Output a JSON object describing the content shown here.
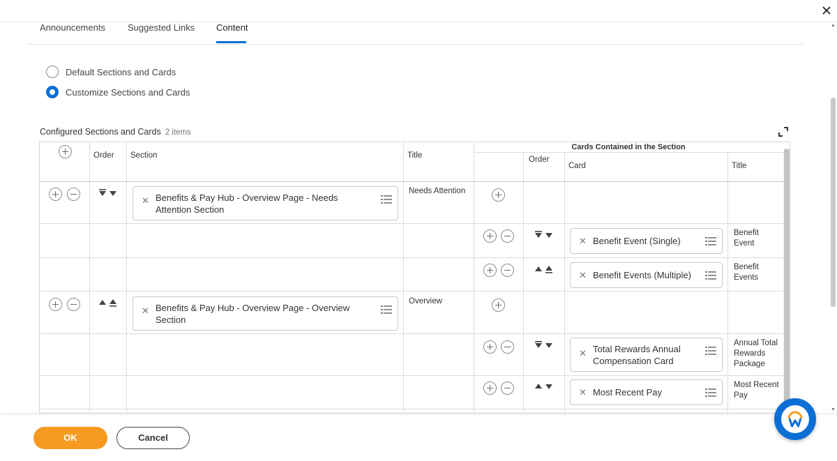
{
  "tabs": [
    {
      "label": "Announcements"
    },
    {
      "label": "Suggested Links"
    },
    {
      "label": "Content"
    }
  ],
  "options": [
    {
      "label": "Default Sections and Cards",
      "selected": false
    },
    {
      "label": "Customize Sections and Cards",
      "selected": true
    }
  ],
  "grid": {
    "title": "Configured Sections and Cards",
    "count": "2 items",
    "headers": {
      "order": "Order",
      "section": "Section",
      "title": "Title",
      "cards_group": "Cards Contained in the Section",
      "card_order": "Order",
      "card": "Card",
      "card_title": "Title"
    },
    "rows": [
      {
        "section": "Benefits & Pay Hub - Overview Page - Needs Attention Section",
        "title": "Needs Attention"
      },
      {
        "card": "Benefit Event (Single)",
        "card_title": "Benefit Event"
      },
      {
        "card": "Benefit Events (Multiple)",
        "card_title": "Benefit Events"
      },
      {
        "section": "Benefits & Pay Hub - Overview Page - Overview Section",
        "title": "Overview"
      },
      {
        "card": "Total Rewards Annual Compensation Card",
        "card_title": "Annual Total Rewards Package"
      },
      {
        "card": "Most Recent Pay",
        "card_title": "Most Recent Pay"
      }
    ]
  },
  "footer": {
    "ok": "OK",
    "cancel": "Cancel"
  },
  "colors": {
    "accent": "#0b6fd6",
    "ok_button": "#f79a22"
  },
  "icons": {
    "close": "close-icon",
    "expand": "expand-icon",
    "list": "prompt-list-icon",
    "help": "workday-assistant-icon"
  }
}
